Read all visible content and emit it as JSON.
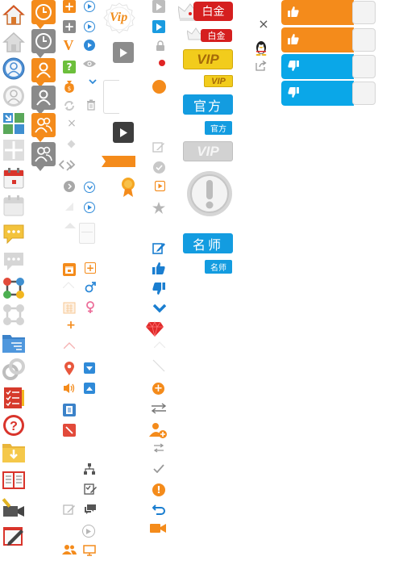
{
  "badges": {
    "platinum": "白金",
    "vip": "VIP",
    "official": "官方",
    "master": "名师"
  },
  "misc": {
    "vip_short": "V",
    "vip_seal": "Vip",
    "plus": "+",
    "help": "?",
    "close": "×"
  },
  "colors": {
    "orange": "#f48b1b",
    "blue": "#0aa7e8",
    "red": "#d21a1a",
    "gold": "#e8b400",
    "gray": "#9a9a9a"
  },
  "toggles": [
    {
      "state": "on",
      "icon": "thumb-up-icon",
      "color": "#f48b1b"
    },
    {
      "state": "on",
      "icon": "thumb-up-icon",
      "color": "#f48b1b"
    },
    {
      "state": "on",
      "icon": "thumb-down-icon",
      "color": "#0aa7e8"
    },
    {
      "state": "on",
      "icon": "thumb-down-icon",
      "color": "#0aa7e8"
    }
  ]
}
